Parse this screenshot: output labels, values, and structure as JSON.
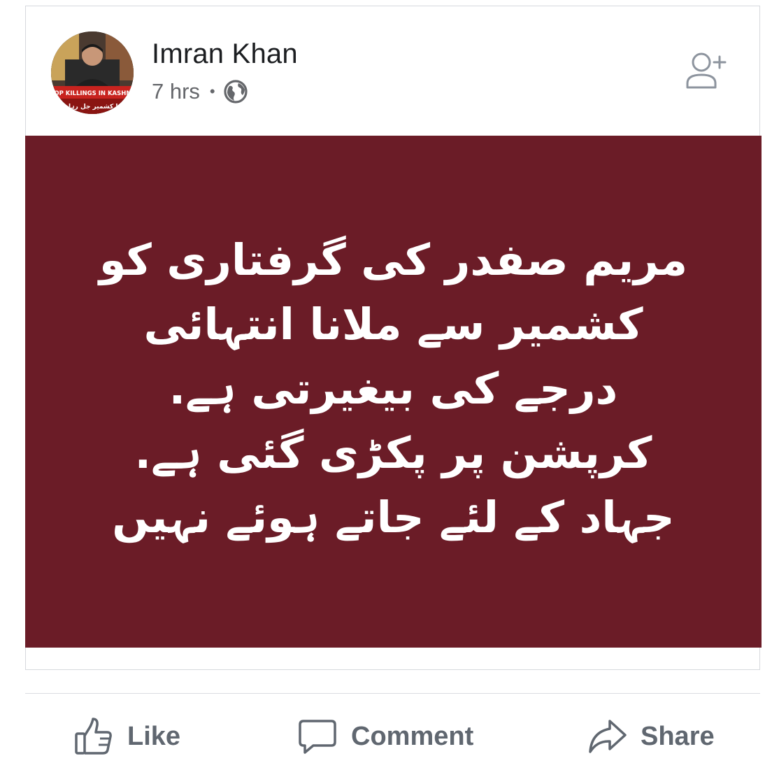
{
  "post": {
    "author": "Imran Khan",
    "timestamp": "7 hrs",
    "separator": "•",
    "privacy_icon": "globe-icon",
    "add_friend_icon": "add-friend-icon",
    "avatar_caption": "STOP KILLINGS IN KASHMIR",
    "avatar_caption_urdu": "مرا کشمیر جل رہا ہے",
    "banner_color": "#6b1c27",
    "banner_lines": [
      "مریم صفدر کی گرفتاری کو",
      "کشمیر سے ملانا انتہائی",
      "درجے کی بیغیرتی ہے.",
      "کرپشن پر پکڑی گئی ہے.",
      "جہاد کے لئے جاتے ہوئے نہیں"
    ]
  },
  "actions": {
    "like_label": "Like",
    "comment_label": "Comment",
    "share_label": "Share"
  }
}
